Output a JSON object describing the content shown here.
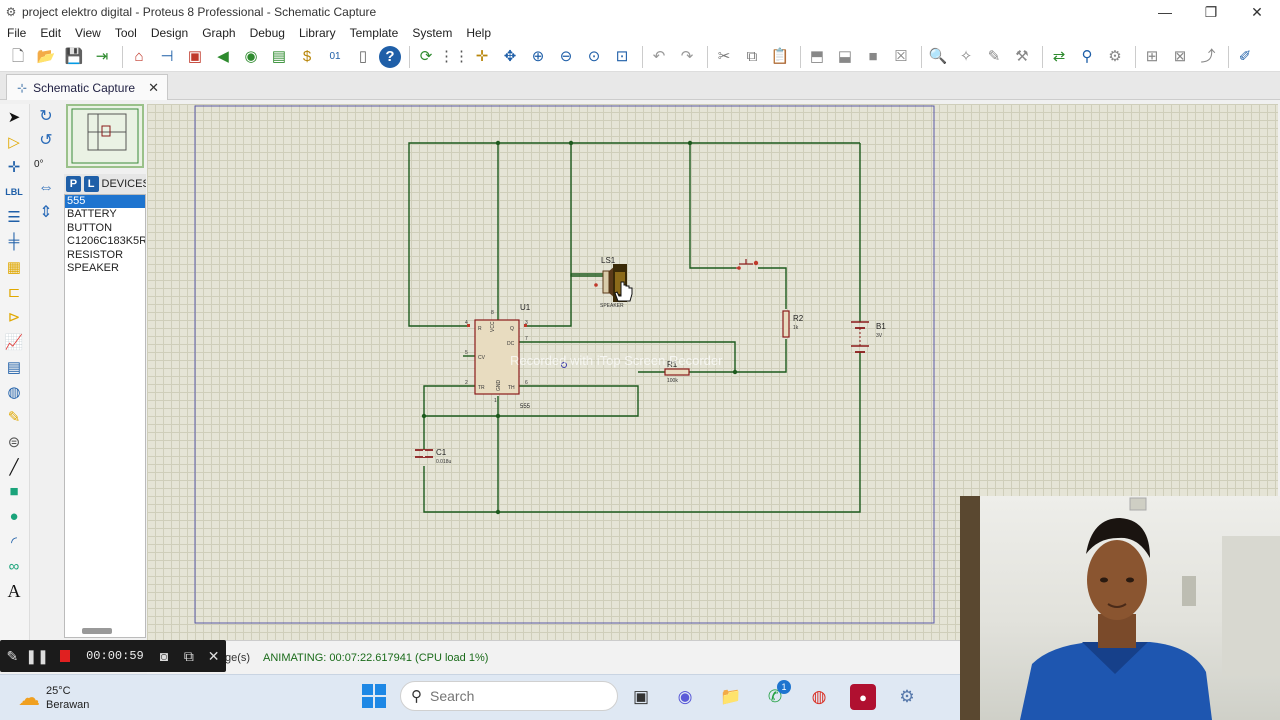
{
  "window": {
    "title": "project elektro digital - Proteus 8 Professional - Schematic Capture",
    "minimize": "—",
    "restore": "❐",
    "close": "✕"
  },
  "menu": [
    "File",
    "Edit",
    "View",
    "Tool",
    "Design",
    "Graph",
    "Debug",
    "Library",
    "Template",
    "System",
    "Help"
  ],
  "toolbar_icons": [
    "new-file-icon",
    "open-folder-icon",
    "save-icon",
    "import-icon",
    "home-icon",
    "schematic-icon",
    "pcb-icon",
    "gerber-icon",
    "3d-view-icon",
    "bom-icon",
    "cost-icon",
    "design-explorer-icon",
    "notes-icon",
    "help-icon",
    "refresh-icon",
    "grid-icon",
    "origin-icon",
    "pan-icon",
    "zoom-in-icon",
    "zoom-out-icon",
    "zoom-all-icon",
    "zoom-area-icon",
    "undo-icon",
    "redo-icon",
    "cut-icon",
    "copy-icon",
    "paste-icon",
    "block-copy-icon",
    "block-move-icon",
    "block-rotate-icon",
    "block-delete-icon",
    "pick-device-icon",
    "make-device-icon",
    "packaging-icon",
    "decompose-icon",
    "wire-autorouter-icon",
    "search-tag-icon",
    "property-assign-icon",
    "new-sheet-icon",
    "remove-sheet-icon",
    "goto-sheet-icon",
    "bom-report-icon"
  ],
  "tab": {
    "label": "Schematic Capture",
    "close": "✕"
  },
  "rotation": {
    "angle": "0°"
  },
  "devices": {
    "p_button": "P",
    "l_button": "L",
    "header": "DEVICES",
    "items": [
      "555",
      "BATTERY",
      "BUTTON",
      "C1206C183K5R",
      "RESISTOR",
      "SPEAKER"
    ],
    "selected_index": 0
  },
  "schematic": {
    "watermark": "Recorded with iTop Screen Recorder",
    "components": {
      "U1": {
        "ref": "U1",
        "value": "555",
        "pins": {
          "R": "R",
          "VCC": "VCC",
          "Q": "Q",
          "DC": "DC",
          "CV": "CV",
          "TR": "TR",
          "GND": "GND",
          "TH": "TH"
        },
        "pin_numbers": {
          "R": "4",
          "VCC": "8",
          "Q": "3",
          "DC": "7",
          "CV": "5",
          "TR": "2",
          "GND": "1",
          "TH": "6"
        }
      },
      "LS1": {
        "ref": "LS1",
        "value": "SPEAKER"
      },
      "R1": {
        "ref": "R1",
        "value": "100k"
      },
      "R2": {
        "ref": "R2",
        "value": "1k"
      },
      "C1": {
        "ref": "C1",
        "value": "0.018u"
      },
      "B1": {
        "ref": "B1",
        "value": "3V"
      }
    }
  },
  "status": {
    "pages": "ge(s)",
    "animating": "ANIMATING: 00:07:22.617941 (CPU load 1%)"
  },
  "recorder": {
    "time": "00:00:59"
  },
  "taskbar": {
    "weather_temp": "25°C",
    "weather_desc": "Berawan",
    "search_placeholder": "Search",
    "whatsapp_badge": "1",
    "apps": [
      "task-view-icon",
      "teams-icon",
      "file-explorer-icon",
      "whatsapp-icon",
      "chrome-icon",
      "screen-recorder-icon",
      "proteus-icon"
    ]
  }
}
